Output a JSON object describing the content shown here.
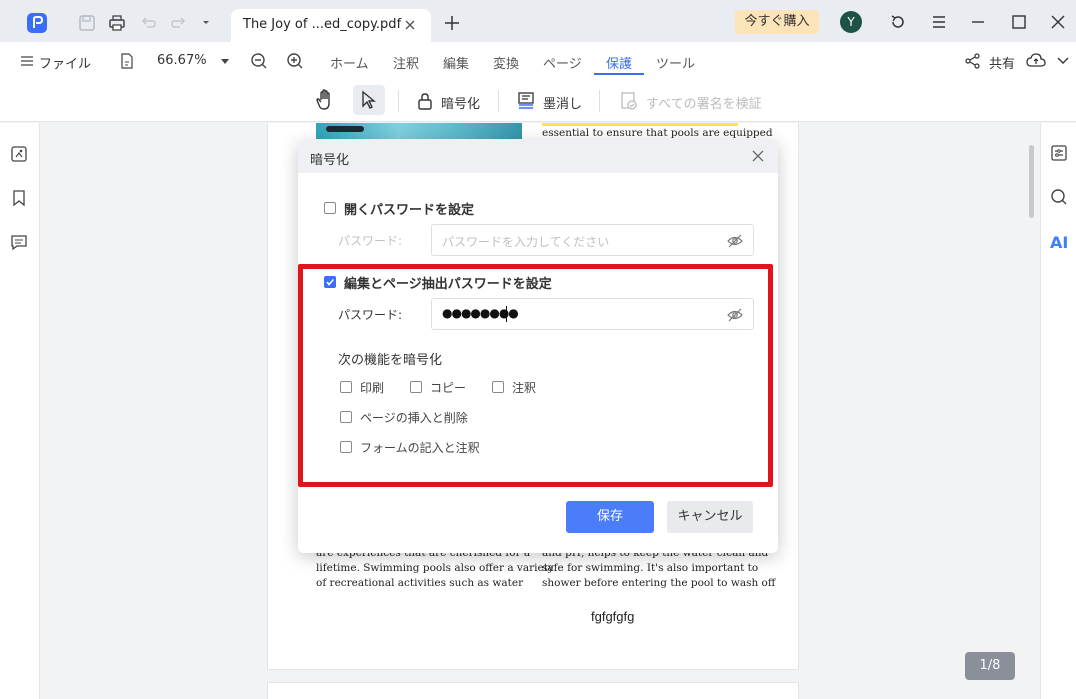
{
  "titlebar": {
    "tab_title": "The Joy of ...ed_copy.pdf",
    "buy_label": "今すぐ購入",
    "avatar_initial": "Y"
  },
  "menubar": {
    "file_label": "ファイル",
    "zoom": "66.67%",
    "tabs": [
      {
        "label": "ホーム"
      },
      {
        "label": "注釈"
      },
      {
        "label": "編集"
      },
      {
        "label": "変換"
      },
      {
        "label": "ページ"
      },
      {
        "label": "保護",
        "active": true
      },
      {
        "label": "ツール"
      }
    ],
    "share_label": "共有"
  },
  "toolbar": {
    "encrypt_label": "暗号化",
    "redact_label": "墨消し",
    "verify_label": "すべての署名を検証"
  },
  "right_panel": {
    "ai_label": "AI"
  },
  "document": {
    "text_top_right": "essential to ensure that pools are equipped",
    "text_left_1": "are experiences that are cherished for a",
    "text_left_2": "lifetime. Swimming pools also offer a variety",
    "text_left_3": "of recreational activities such as water",
    "text_right_1": "and pH, helps to keep the water clean and",
    "text_right_2": "safe for swimming. It's also important to",
    "text_right_3": "shower before entering the pool to wash off",
    "text_center": "fgfgfgfg",
    "page_indicator": "1/8"
  },
  "dialog": {
    "title": "暗号化",
    "open_password": {
      "label": "開くパスワードを設定",
      "checked": false,
      "field_label": "パスワード:",
      "placeholder": "パスワードを入力してください"
    },
    "edit_password": {
      "label": "編集とページ抽出パスワードを設定",
      "checked": true,
      "field_label": "パスワード:",
      "value": "●●●●●●●●"
    },
    "restrict_label": "次の機能を暗号化",
    "options": [
      {
        "label": "印刷",
        "checked": false
      },
      {
        "label": "コピー",
        "checked": false
      },
      {
        "label": "注釈",
        "checked": false
      },
      {
        "label": "ページの挿入と削除",
        "checked": false
      },
      {
        "label": "フォームの記入と注釈",
        "checked": false
      }
    ],
    "save_label": "保存",
    "cancel_label": "キャンセル"
  },
  "colors": {
    "accent": "#3b6ef6",
    "highlight_red": "#e0141c",
    "buy_bg": "#fde3b8",
    "avatar_bg": "#1e5245"
  },
  "icons": [
    "app-logo-icon",
    "save-icon",
    "print-icon",
    "undo-icon",
    "redo-icon",
    "chevron-down-icon",
    "close-icon",
    "plus-icon",
    "sync-icon",
    "hamburger-icon",
    "maximize-icon",
    "share-icon",
    "cloud-upload-icon",
    "hand-icon",
    "cursor-icon",
    "lock-icon",
    "redact-icon",
    "signature-verify-icon",
    "thumbnail-icon",
    "bookmark-icon",
    "comment-icon",
    "properties-icon",
    "search-icon",
    "eye-off-icon"
  ]
}
